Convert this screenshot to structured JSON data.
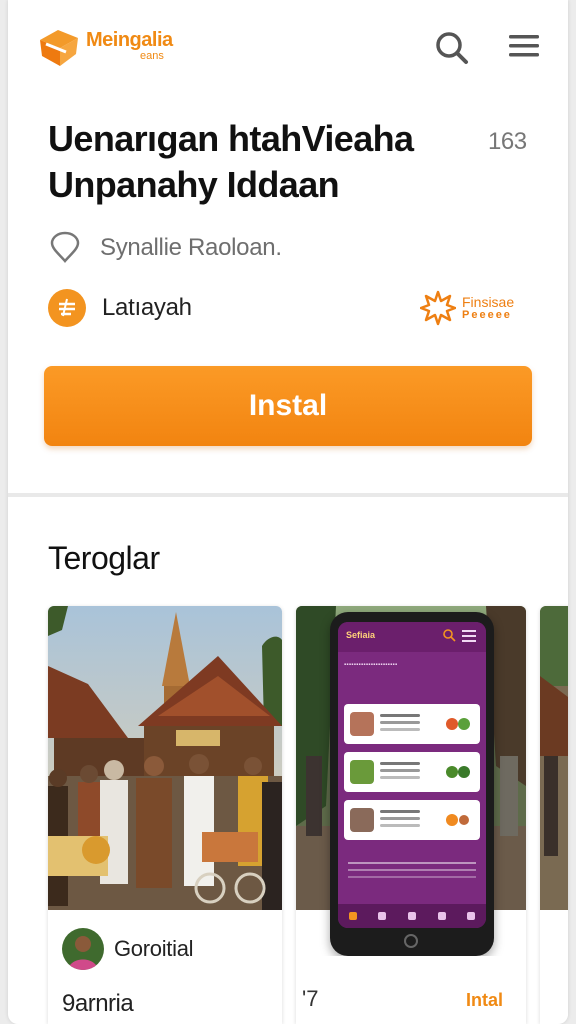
{
  "header": {
    "logo_name": "Meingalia",
    "logo_sub": "eans",
    "search_icon": "search-icon",
    "menu_icon": "menu-icon"
  },
  "app": {
    "title_line1": "Uenarıgan htahVieaha",
    "title_line2": "Unpanahy Iddaan",
    "count": "163",
    "location": "Synallie Raoloan.",
    "language": "Latıayah",
    "badge_title": "Finsisae",
    "badge_sub": "Peeeee",
    "install_label": "Instal"
  },
  "section": {
    "title": "Teroglar"
  },
  "cards": [
    {
      "name": "Goroitial",
      "sub": "9arnria"
    },
    {
      "num": "'7",
      "install_label": "Intal",
      "screen_brand": "Sefiaia"
    }
  ],
  "colors": {
    "accent": "#f28a14",
    "phone_screen": "#7b2a7e"
  }
}
